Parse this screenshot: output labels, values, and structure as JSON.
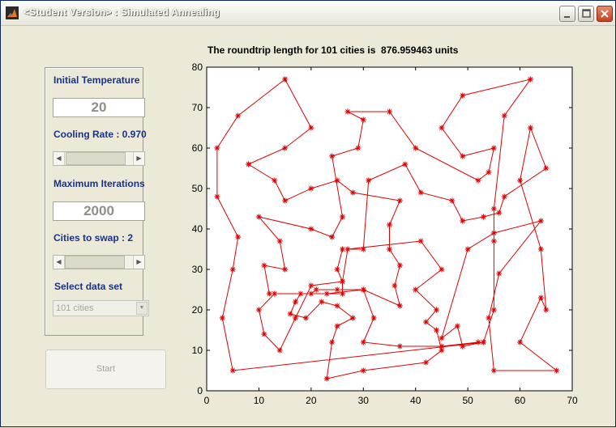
{
  "window": {
    "title": "<Student Version> : Simulated Annealing"
  },
  "controls": {
    "initial_temperature_label": "Initial Temperature",
    "initial_temperature_value": "20",
    "cooling_rate_label": "Cooling Rate : 0.970",
    "cooling_rate_slider": 0.2,
    "max_iterations_label": "Maximum Iterations",
    "max_iterations_value": "2000",
    "cities_to_swap_label": "Cities to swap : 2",
    "cities_to_swap_slider": 0.05,
    "data_set_label": "Select data set",
    "data_set_selected": "101 cities",
    "start_label": "Start"
  },
  "chart_data": {
    "type": "line",
    "title": "The roundtrip length for 101 cities is  876.959463 units",
    "xlim": [
      0,
      70
    ],
    "ylim": [
      0,
      80
    ],
    "xticks": [
      0,
      10,
      20,
      30,
      40,
      50,
      60,
      70
    ],
    "yticks": [
      0,
      10,
      20,
      30,
      40,
      50,
      60,
      70,
      80
    ],
    "grid": false,
    "marker": "*",
    "series": [
      {
        "color": "#e00000",
        "points": [
          [
            15,
            77
          ],
          [
            20,
            65
          ],
          [
            15,
            60
          ],
          [
            8,
            56
          ],
          [
            13,
            52
          ],
          [
            15,
            47
          ],
          [
            20,
            50
          ],
          [
            25,
            52
          ],
          [
            28,
            49
          ],
          [
            37,
            47
          ],
          [
            35,
            41
          ],
          [
            35,
            35
          ],
          [
            37,
            31
          ],
          [
            36,
            26
          ],
          [
            37,
            21
          ],
          [
            30,
            25
          ],
          [
            25,
            25
          ],
          [
            21,
            25
          ],
          [
            20,
            24
          ],
          [
            26,
            24
          ],
          [
            26,
            27
          ],
          [
            27,
            35
          ],
          [
            41,
            37
          ],
          [
            45,
            30
          ],
          [
            40,
            25
          ],
          [
            44,
            20
          ],
          [
            42,
            17
          ],
          [
            44,
            15
          ],
          [
            45,
            10
          ],
          [
            42,
            7
          ],
          [
            30,
            5
          ],
          [
            23,
            3
          ],
          [
            24,
            12
          ],
          [
            25,
            16
          ],
          [
            28,
            18
          ],
          [
            25,
            21
          ],
          [
            22,
            22
          ],
          [
            19,
            18
          ],
          [
            16,
            19
          ],
          [
            17,
            22
          ],
          [
            18,
            24
          ],
          [
            12,
            24
          ],
          [
            11,
            31
          ],
          [
            15,
            30
          ],
          [
            14,
            37
          ],
          [
            10,
            43
          ],
          [
            20,
            40
          ],
          [
            24,
            38
          ],
          [
            26,
            43
          ],
          [
            24,
            58
          ],
          [
            29,
            60
          ],
          [
            30,
            67
          ],
          [
            27,
            69
          ],
          [
            35,
            69
          ],
          [
            40,
            60
          ],
          [
            52,
            52
          ],
          [
            54,
            54
          ],
          [
            55,
            60
          ],
          [
            49,
            58
          ],
          [
            45,
            65
          ],
          [
            49,
            73
          ],
          [
            62,
            77
          ],
          [
            57,
            68
          ],
          [
            55,
            45
          ],
          [
            55,
            37
          ],
          [
            55,
            20
          ],
          [
            53,
            12
          ],
          [
            49,
            11
          ],
          [
            48,
            16
          ],
          [
            45,
            13
          ],
          [
            50,
            35
          ],
          [
            55,
            39
          ],
          [
            64,
            42
          ],
          [
            56,
            29
          ],
          [
            54,
            18
          ],
          [
            55,
            5
          ],
          [
            67,
            5
          ],
          [
            60,
            12
          ],
          [
            64,
            23
          ],
          [
            65,
            20
          ],
          [
            64,
            35
          ],
          [
            60,
            52
          ],
          [
            62,
            65
          ],
          [
            65,
            55
          ],
          [
            57,
            48
          ],
          [
            56,
            44
          ],
          [
            53,
            43
          ],
          [
            49,
            42
          ],
          [
            47,
            47
          ],
          [
            41,
            49
          ],
          [
            38,
            56
          ],
          [
            31,
            52
          ],
          [
            30,
            35
          ],
          [
            26,
            35
          ],
          [
            25,
            30
          ],
          [
            26,
            27
          ],
          [
            20,
            26
          ],
          [
            17,
            18
          ],
          [
            14,
            10
          ],
          [
            11,
            14
          ],
          [
            10,
            20
          ],
          [
            13,
            24
          ],
          [
            23,
            24
          ],
          [
            30,
            25
          ],
          [
            32,
            18
          ],
          [
            30,
            12
          ],
          [
            37,
            11
          ],
          [
            45,
            11
          ],
          [
            52,
            12
          ],
          [
            53,
            12
          ],
          [
            5,
            5
          ],
          [
            3,
            18
          ],
          [
            5,
            30
          ],
          [
            6,
            38
          ],
          [
            2,
            48
          ],
          [
            2,
            60
          ],
          [
            6,
            68
          ],
          [
            15,
            77
          ]
        ]
      }
    ]
  }
}
